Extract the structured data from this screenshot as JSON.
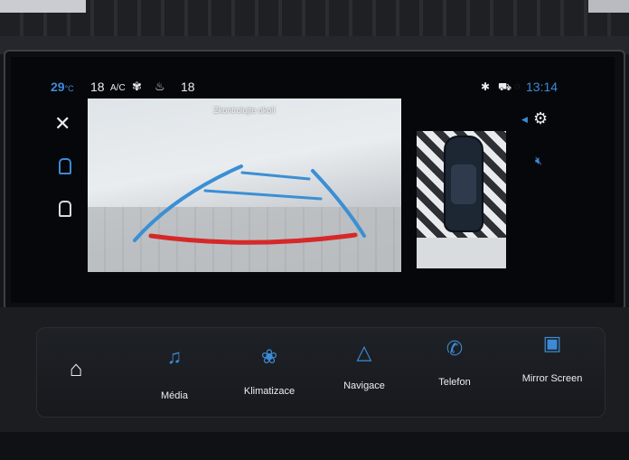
{
  "status_bar": {
    "outside_temp": "29",
    "outside_unit": "°C",
    "temp_left": "18",
    "ac_label": "A/C",
    "fan_icon": "fan-icon",
    "seat_icon": "seat-heat-icon",
    "temp_right": "18",
    "bluetooth_icon": "bluetooth-icon",
    "car_icon": "car-front-icon",
    "signal_icon": "signal-icon",
    "time": "13:14"
  },
  "camera": {
    "warning": "Zkontrolujte okolí"
  },
  "nav": {
    "items": [
      {
        "label": "",
        "icon": "home-icon"
      },
      {
        "label": "Média",
        "icon": "music-icon"
      },
      {
        "label": "Klimatizace",
        "icon": "fan-thermometer-icon"
      },
      {
        "label": "Navigace",
        "icon": "navigation-arrow-icon"
      },
      {
        "label": "Telefon",
        "icon": "phone-icon"
      },
      {
        "label": "Mirror Screen",
        "icon": "mirror-screen-icon"
      }
    ]
  },
  "colors": {
    "accent": "#3d8ad6",
    "guide_blue": "#3b8fd4",
    "guide_red": "#d62828"
  }
}
